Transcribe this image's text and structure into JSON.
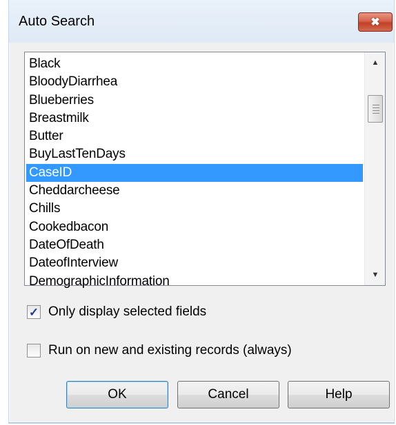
{
  "dialog": {
    "title": "Auto Search",
    "close_glyph": "✖"
  },
  "list": {
    "items": [
      "Black",
      "BloodyDiarrhea",
      "Blueberries",
      "Breastmilk",
      "Butter",
      "BuyLastTenDays",
      "CaseID",
      "Cheddarcheese",
      "Chills",
      "Cookedbacon",
      "DateOfDeath",
      "DateofInterview",
      "DemographicInformation"
    ],
    "selected_item": "CaseID",
    "scroll_up_icon": "triangle-up-icon",
    "scroll_down_icon": "triangle-down-icon"
  },
  "options": {
    "only_display_selected": {
      "label": "Only display selected fields",
      "checked": true
    },
    "run_on_records": {
      "label": "Run on new and existing records (always)",
      "checked": false
    }
  },
  "buttons": {
    "ok": "OK",
    "cancel": "Cancel",
    "help": "Help"
  },
  "colors": {
    "selection": "#3399ff",
    "close_button": "#c34126"
  }
}
